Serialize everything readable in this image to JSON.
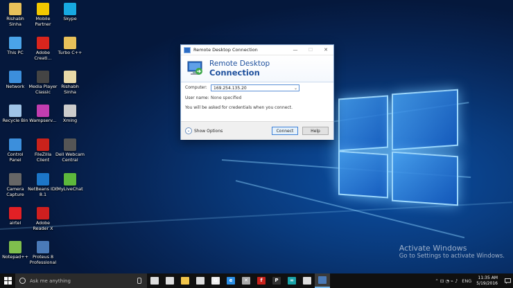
{
  "desktop_icons": [
    {
      "label_1": "Rishabh",
      "label_2": "Sinha",
      "icon": "folder-icon",
      "color": "#e8c15a"
    },
    {
      "label_1": "Mobile",
      "label_2": "Partner",
      "icon": "mobile-partner-icon",
      "color": "#f2c800"
    },
    {
      "label_1": "Skype",
      "label_2": "",
      "icon": "skype-icon",
      "color": "#17a9e1"
    },
    {
      "label_1": "This PC",
      "label_2": "",
      "icon": "this-pc-icon",
      "color": "#4aa3e8"
    },
    {
      "label_1": "Adobe",
      "label_2": "Creati...",
      "icon": "adobe-creative-icon",
      "color": "#d9251d"
    },
    {
      "label_1": "Turbo C++",
      "label_2": "",
      "icon": "turbo-cpp-icon",
      "color": "#e8c15a"
    },
    {
      "label_1": "Network",
      "label_2": "",
      "icon": "network-icon",
      "color": "#3c8fdc"
    },
    {
      "label_1": "Media Player",
      "label_2": "Classic",
      "icon": "media-player-icon",
      "color": "#444444"
    },
    {
      "label_1": "Rishabh",
      "label_2": "Sinha",
      "icon": "document-icon",
      "color": "#e8d9a8"
    },
    {
      "label_1": "Recycle Bin",
      "label_2": "",
      "icon": "recycle-bin-icon",
      "color": "#9fc4e8"
    },
    {
      "label_1": "Wampserv...",
      "label_2": "",
      "icon": "wampserver-icon",
      "color": "#c23db0"
    },
    {
      "label_1": "Xming",
      "label_2": "",
      "icon": "xming-icon",
      "color": "#cccccc"
    },
    {
      "label_1": "Control",
      "label_2": "Panel",
      "icon": "control-panel-icon",
      "color": "#3c8fdc"
    },
    {
      "label_1": "FileZilla",
      "label_2": "Client",
      "icon": "filezilla-icon",
      "color": "#c9221b"
    },
    {
      "label_1": "Dell Webcam",
      "label_2": "Central",
      "icon": "webcam-icon",
      "color": "#555555"
    },
    {
      "label_1": "Camera",
      "label_2": "Capture",
      "icon": "camera-icon",
      "color": "#666666"
    },
    {
      "label_1": "NetBeans IDE",
      "label_2": "8.1",
      "icon": "netbeans-icon",
      "color": "#1c76c8"
    },
    {
      "label_1": "MyLiveChat",
      "label_2": "",
      "icon": "mylivechat-icon",
      "color": "#5db83c"
    },
    {
      "label_1": "airtel",
      "label_2": "",
      "icon": "airtel-icon",
      "color": "#e22025"
    },
    {
      "label_1": "Adobe",
      "label_2": "Reader X",
      "icon": "adobe-reader-icon",
      "color": "#cf1f1f"
    },
    {
      "label_1": "Notepad++",
      "label_2": "",
      "icon": "notepadpp-icon",
      "color": "#7fbf4d"
    },
    {
      "label_1": "Proteus 8",
      "label_2": "Professional",
      "icon": "proteus-icon",
      "color": "#4a7ab8"
    }
  ],
  "rdc_window": {
    "title": "Remote Desktop Connection",
    "banner_line1": "Remote Desktop",
    "banner_line2": "Connection",
    "computer_label": "Computer:",
    "computer_value": "169.254.135.20",
    "username_label": "User name:",
    "username_value": "None specified",
    "credentials_note": "You will be asked for credentials when you connect.",
    "show_options": "Show Options",
    "connect_button": "Connect",
    "help_button": "Help",
    "minimize": "—",
    "maximize": "☐",
    "close": "✕"
  },
  "watermark": {
    "line1": "Activate Windows",
    "line2": "Go to Settings to activate Windows."
  },
  "taskbar": {
    "search_placeholder": "Ask me anything",
    "pinned": [
      {
        "icon": "task-view-icon",
        "glyph": "",
        "color": "#dddddd"
      },
      {
        "icon": "store-icon",
        "glyph": "",
        "color": "#dddddd"
      },
      {
        "icon": "file-explorer-icon",
        "glyph": "",
        "color": "#f2c54a"
      },
      {
        "icon": "mail-icon",
        "glyph": "",
        "color": "#dddddd"
      },
      {
        "icon": "chrome-icon",
        "glyph": "G",
        "color": "#eeeeee"
      },
      {
        "icon": "edge-icon",
        "glyph": "e",
        "color": "#2b8fe6"
      },
      {
        "icon": "xming-taskbar-icon",
        "glyph": "✕",
        "color": "#aaaaaa"
      },
      {
        "icon": "filezilla-taskbar-icon",
        "glyph": "f",
        "color": "#c9221b"
      },
      {
        "icon": "p-app-icon",
        "glyph": "P",
        "color": "#333333"
      },
      {
        "icon": "arduino-icon",
        "glyph": "∞",
        "color": "#1aa3a8"
      },
      {
        "icon": "image-app-icon",
        "glyph": "",
        "color": "#dddddd"
      },
      {
        "icon": "rdc-taskbar-icon",
        "glyph": "",
        "color": "#4a7ab8"
      }
    ],
    "tray_glyphs": "⌃  ⊡  ◔  ⌁  ♪",
    "language": "ENG",
    "time": "11:35 AM",
    "date": "5/19/2016"
  }
}
